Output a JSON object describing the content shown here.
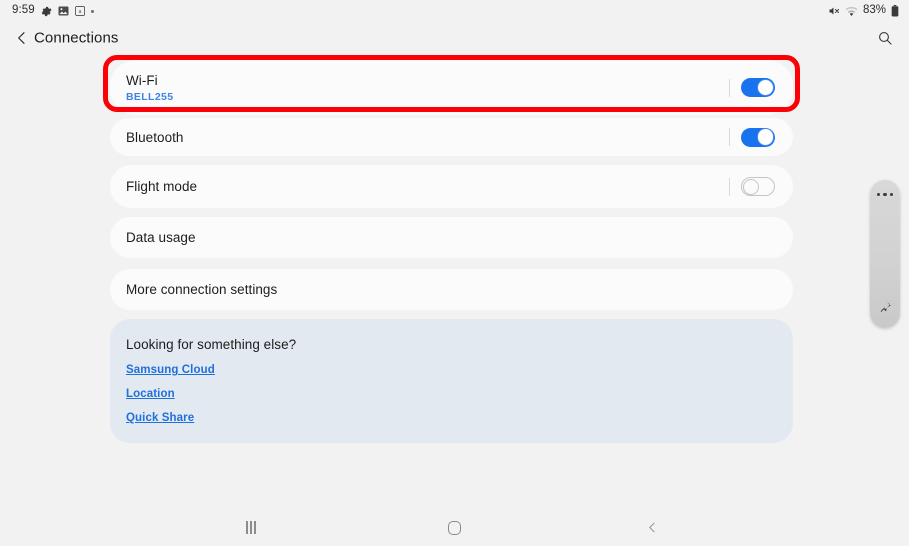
{
  "status_bar": {
    "clock": "9:59",
    "left_icons": [
      "settings-gear-icon",
      "photo-icon",
      "screenshot-icon",
      "more-dot-icon"
    ],
    "battery_percent": "83%",
    "right_icons": [
      "mute-icon",
      "wifi-icon",
      "battery-icon"
    ]
  },
  "app_bar": {
    "back_label": "back-arrow",
    "title": "Connections",
    "search_label": "search-icon"
  },
  "settings": {
    "items": [
      {
        "title": "Wi-Fi",
        "subtitle": "BELL255",
        "control": "switch",
        "state": "on",
        "highlighted": true
      },
      {
        "title": "Bluetooth",
        "subtitle": "",
        "control": "switch",
        "state": "on",
        "highlighted": false
      },
      {
        "title": "Flight mode",
        "subtitle": "",
        "control": "switch",
        "state": "off",
        "highlighted": false
      },
      {
        "title": "Data usage",
        "subtitle": "",
        "control": "none",
        "state": "",
        "highlighted": false
      },
      {
        "title": "More connection settings",
        "subtitle": "",
        "control": "none",
        "state": "",
        "highlighted": false
      }
    ]
  },
  "info_panel": {
    "heading": "Looking for something else?",
    "links": [
      "Samsung Cloud",
      "Location",
      "Quick Share"
    ]
  },
  "edge_panel": {
    "handle_name": "edge-panel-handle",
    "bottom_icon": "pin-icon"
  },
  "nav_bar": {
    "recents": "recents-icon",
    "home": "home-icon",
    "back": "back-icon"
  },
  "colors": {
    "page_background": "#f2f2f2",
    "card_background": "#fbfbfb",
    "accent_blue": "#1a73ee",
    "link_blue": "#1f6fdd",
    "subtitle_blue": "#3f84e8",
    "info_panel_background": "#e3e9f0",
    "highlight_red": "#fb0007",
    "text_primary": "#1d1d1d"
  }
}
